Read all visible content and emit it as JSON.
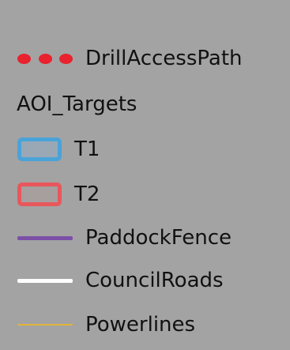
{
  "legend": {
    "background": "#a3a3a3",
    "items": [
      {
        "label": "DrillAccessPath",
        "symbol": "dotted-line",
        "color": "#e8222e"
      },
      {
        "label": "T1",
        "symbol": "polygon-outline",
        "color": "#4aa3d8",
        "fill": "#9aa8b6"
      },
      {
        "label": "T2",
        "symbol": "polygon-outline",
        "color": "#e8575c",
        "fill": "#a79e9e"
      },
      {
        "label": "PaddockFence",
        "symbol": "line",
        "color": "#7b4fa8"
      },
      {
        "label": "CouncilRoads",
        "symbol": "line",
        "color": "#ffffff"
      },
      {
        "label": "Powerlines",
        "symbol": "line",
        "color": "#e0b43a"
      }
    ],
    "group_header": "AOI_Targets"
  }
}
